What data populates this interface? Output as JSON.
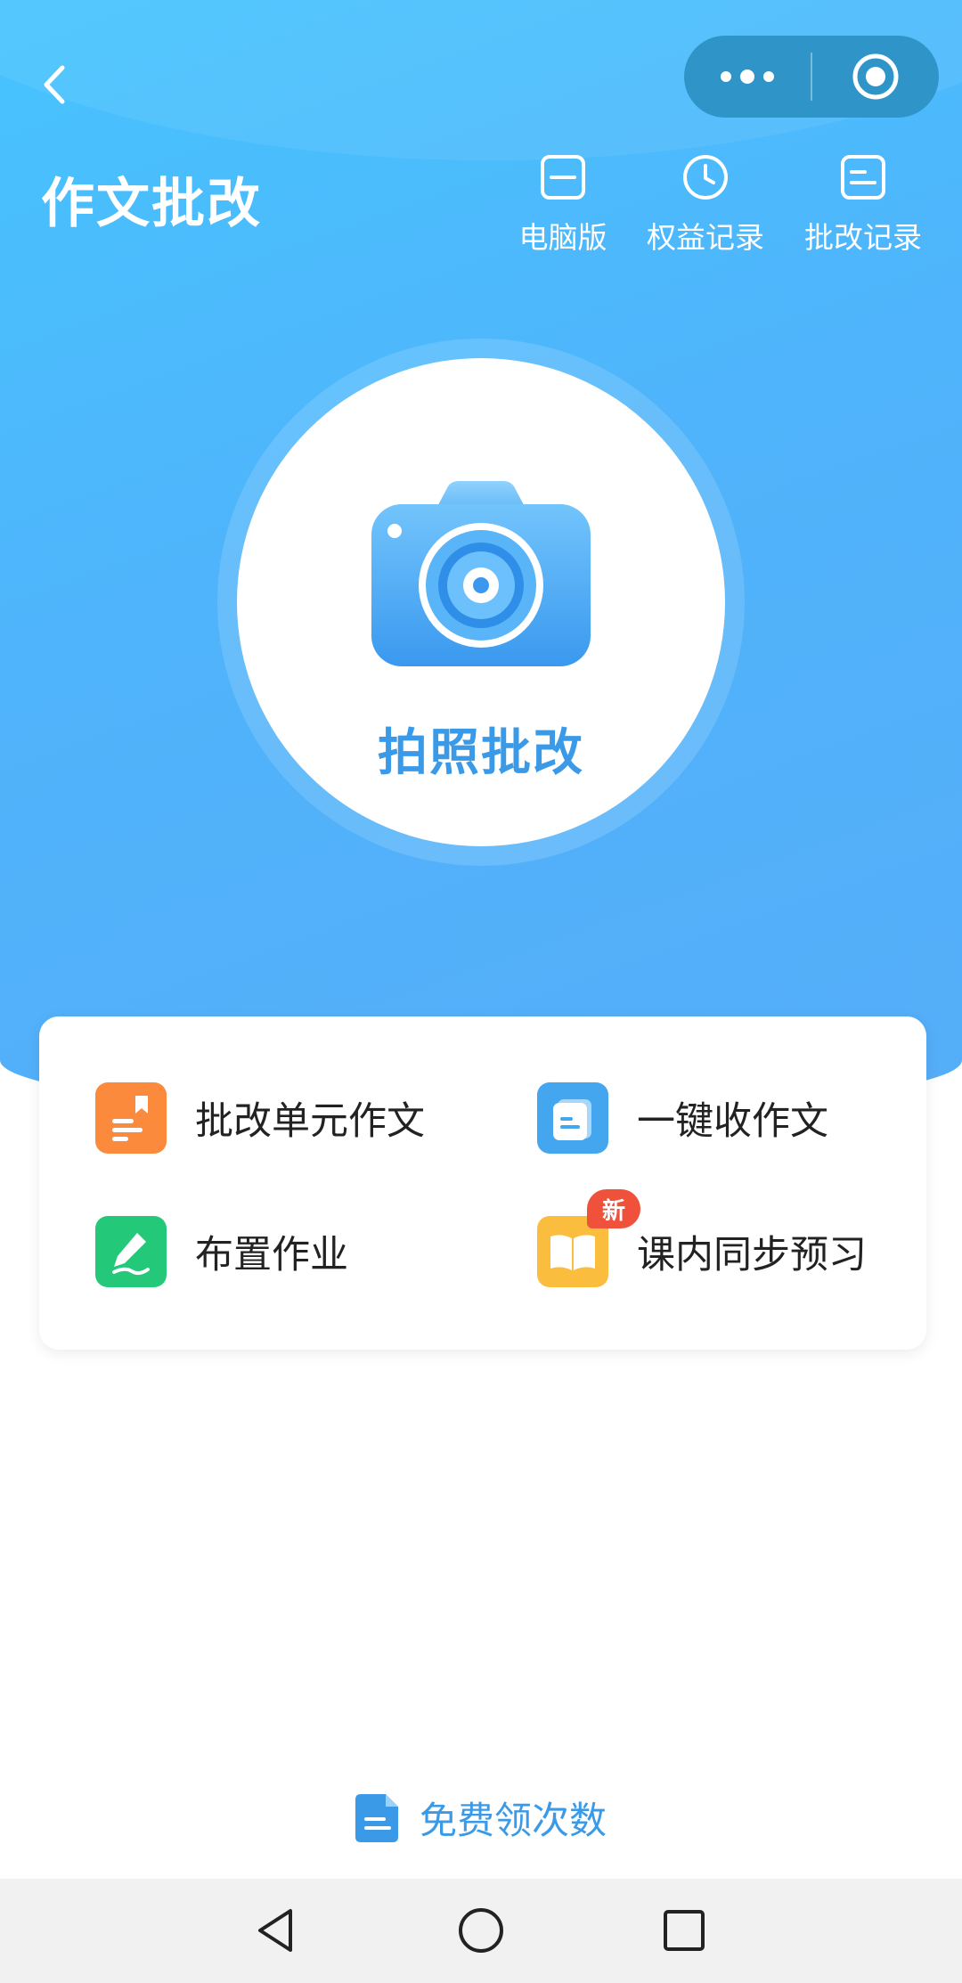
{
  "header": {
    "title": "作文批改",
    "actions": [
      {
        "label": "电脑版",
        "icon": "desktop-icon"
      },
      {
        "label": "权益记录",
        "icon": "clock-icon"
      },
      {
        "label": "批改记录",
        "icon": "record-icon"
      }
    ],
    "capsule": {
      "more_icon": "more-dots-icon",
      "close_icon": "target-icon"
    }
  },
  "main": {
    "photo_button_label": "拍照批改"
  },
  "features": [
    {
      "label": "批改单元作文",
      "icon": "unit-essay-icon",
      "color": "#fb8a3c"
    },
    {
      "label": "一键收作文",
      "icon": "collect-essay-icon",
      "color": "#43a6ee"
    },
    {
      "label": "布置作业",
      "icon": "pen-icon",
      "color": "#23c978"
    },
    {
      "label": "课内同步预习",
      "icon": "book-icon",
      "color": "#fbbd3d",
      "badge": "新"
    }
  ],
  "footer": {
    "free_label": "免费领次数"
  },
  "colors": {
    "hero_start": "#47c4fe",
    "hero_end": "#55adf8",
    "accent": "#3a9ae8",
    "badge": "#f0513a"
  }
}
